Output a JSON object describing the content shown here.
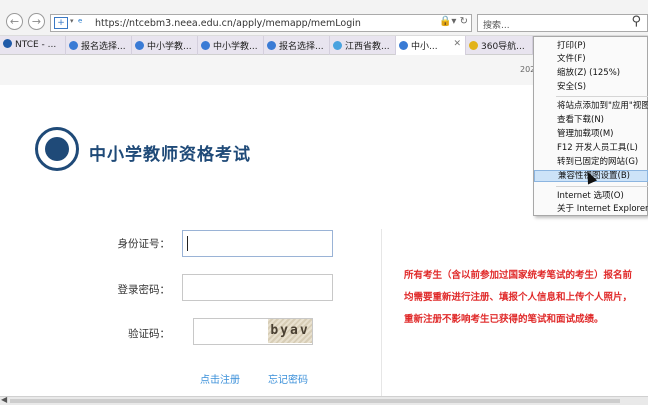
{
  "browser": {
    "url": "https://ntcebm3.neea.edu.cn/apply/memapp/memLogin",
    "search_placeholder": "搜索..."
  },
  "tabs": [
    {
      "label": "NTCE - ...",
      "icon_color": "#1f5aa8"
    },
    {
      "label": "报名选择...",
      "icon_color": "#3a7bd5"
    },
    {
      "label": "中小学教...",
      "icon_color": "#3a7bd5"
    },
    {
      "label": "中小学教...",
      "icon_color": "#3a7bd5"
    },
    {
      "label": "报名选择...",
      "icon_color": "#3a7bd5"
    },
    {
      "label": "江西省教...",
      "icon_color": "#4aa3df"
    },
    {
      "label": "中小...",
      "icon_color": "#3a7bd5"
    },
    {
      "label": "360导航...",
      "icon_color": "#e2b31a"
    }
  ],
  "page": {
    "year_text": "202",
    "title": "中小学教师资格考试",
    "id_label": "身份证号：",
    "password_label": "登录密码：",
    "captcha_label": "验证码：",
    "captcha_text": "byav",
    "register_link": "点击注册",
    "forgot_link": "忘记密码",
    "notice": "所有考生（含以前参加过国家统考笔试的考生）报名前均需要重新进行注册、填报个人信息和上传个人照片，重新注册不影响考生已获得的笔试和面试成绩。"
  },
  "menu": {
    "items": [
      {
        "label": "打印(P)",
        "highlight": false
      },
      {
        "label": "文件(F)",
        "highlight": false
      },
      {
        "label": "缩放(Z) (125%)",
        "highlight": false
      },
      {
        "label": "安全(S)",
        "highlight": false
      },
      {
        "label": "将站点添加到\"应用\"视图",
        "highlight": false
      },
      {
        "label": "查看下载(N)",
        "highlight": false
      },
      {
        "label": "管理加载项(M)",
        "highlight": false
      },
      {
        "label": "F12 开发人员工具(L)",
        "highlight": false
      },
      {
        "label": "转到已固定的网站(G)",
        "highlight": false
      },
      {
        "label": "兼容性视图设置(B)",
        "highlight": true
      },
      {
        "label": "Internet 选项(O)",
        "highlight": false
      },
      {
        "label": "关于 Internet Explorer",
        "highlight": false
      }
    ]
  },
  "colors": {
    "brand_blue": "#1f4a78",
    "notice_red": "#e02a2a",
    "link_blue": "#3a8fd9"
  }
}
